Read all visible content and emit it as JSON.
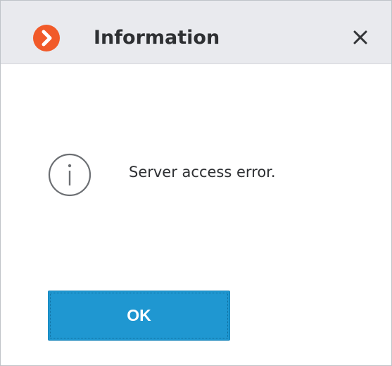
{
  "dialog": {
    "title": "Information",
    "message": "Server access error.",
    "ok_label": "OK"
  },
  "icons": {
    "app": "app-logo-icon",
    "close": "close-icon",
    "info": "info-icon"
  },
  "colors": {
    "title_bar": "#e9eaee",
    "accent": "#1f97d1",
    "logo": "#f15a29",
    "text": "#2e3033"
  }
}
